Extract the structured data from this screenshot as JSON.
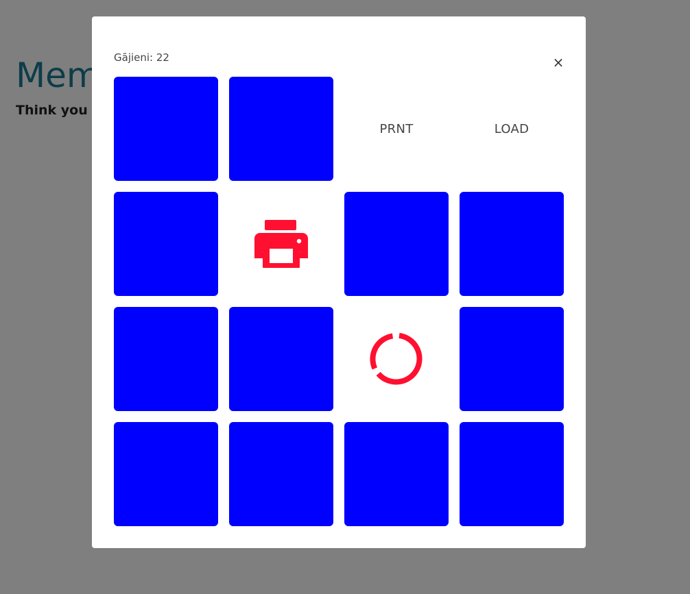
{
  "background": {
    "title": "Mem",
    "subtitle": "Think you c"
  },
  "modal": {
    "close_label": "×",
    "moves_text": "Gājieni: 22"
  },
  "colors": {
    "card_back": "#0000ff",
    "icon_accent": "#ff1030",
    "overlay": "rgba(0,0,0,0.5)"
  },
  "cards": [
    {
      "state": "face-down"
    },
    {
      "state": "face-down"
    },
    {
      "state": "face-up",
      "kind": "text",
      "text": "PRNT"
    },
    {
      "state": "face-up",
      "kind": "text",
      "text": "LOAD"
    },
    {
      "state": "face-down"
    },
    {
      "state": "face-up",
      "kind": "icon",
      "icon": "printer-icon"
    },
    {
      "state": "face-down"
    },
    {
      "state": "face-down"
    },
    {
      "state": "face-down"
    },
    {
      "state": "face-down"
    },
    {
      "state": "face-up",
      "kind": "icon",
      "icon": "loading-circle-icon"
    },
    {
      "state": "face-down"
    },
    {
      "state": "face-down"
    },
    {
      "state": "face-down"
    },
    {
      "state": "face-down"
    },
    {
      "state": "face-down"
    }
  ]
}
